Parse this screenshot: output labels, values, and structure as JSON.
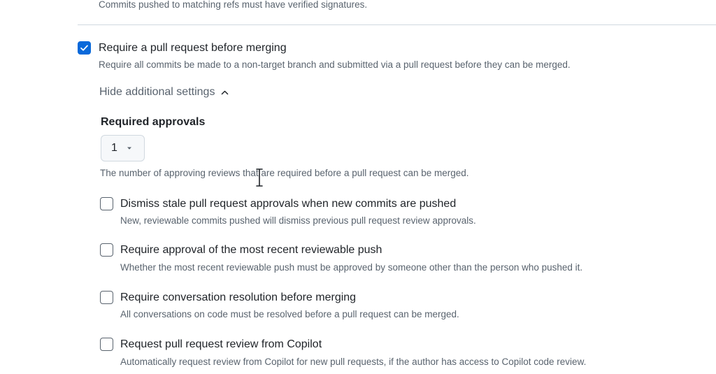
{
  "top": {
    "description": "Commits pushed to matching refs must have verified signatures."
  },
  "pull_request_rule": {
    "checked": true,
    "title": "Require a pull request before merging",
    "description": "Require all commits be made to a non-target branch and submitted via a pull request before they can be merged."
  },
  "toggle": {
    "label": "Hide additional settings",
    "icon": "chevron-up-icon"
  },
  "approvals": {
    "label": "Required approvals",
    "selected_value": "1",
    "help_text": "The number of approving reviews that are required before a pull request can be merged."
  },
  "options": [
    {
      "title": "Dismiss stale pull request approvals when new commits are pushed",
      "description": "New, reviewable commits pushed will dismiss previous pull request review approvals.",
      "checked": false
    },
    {
      "title": "Require approval of the most recent reviewable push",
      "description": "Whether the most recent reviewable push must be approved by someone other than the person who pushed it.",
      "checked": false
    },
    {
      "title": "Require conversation resolution before merging",
      "description": "All conversations on code must be resolved before a pull request can be merged.",
      "checked": false
    },
    {
      "title": "Request pull request review from Copilot",
      "description": "Automatically request review from Copilot for new pull requests, if the author has access to Copilot code review.",
      "checked": false
    }
  ],
  "colors": {
    "accent": "#0969da",
    "text_primary": "#1f2328",
    "text_muted": "#59636e",
    "border": "#d1d9e0"
  }
}
